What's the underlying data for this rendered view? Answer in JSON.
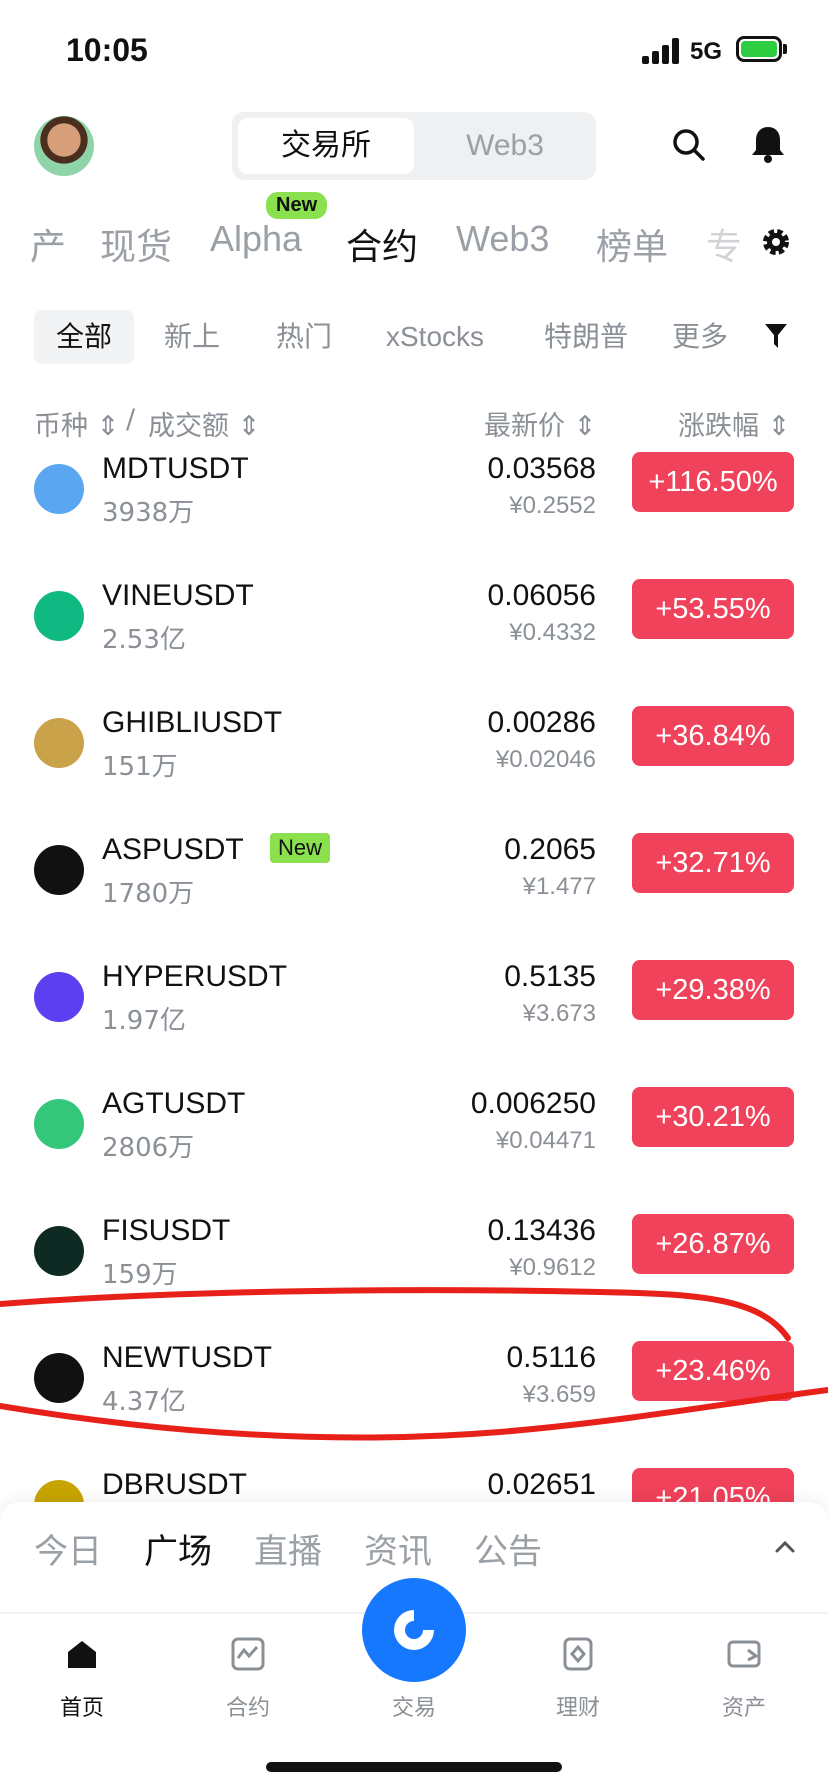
{
  "status_bar": {
    "time": "10:05",
    "network": "5G"
  },
  "header": {
    "segment": [
      "交易所",
      "Web3"
    ]
  },
  "main_tabs": {
    "items": [
      "产",
      "现货",
      "Alpha",
      "合约",
      "Web3",
      "榜单",
      "专"
    ],
    "active": "合约",
    "badge": "New"
  },
  "filters": {
    "items": [
      "全部",
      "新上",
      "热门",
      "xStocks",
      "特朗普",
      "更多"
    ],
    "active": "全部"
  },
  "columns": {
    "coin": "币种",
    "slash": "/",
    "volume": "成交额",
    "price": "最新价",
    "change": "涨跌幅"
  },
  "rows": [
    {
      "symbol": "MDTUSDT",
      "volume": "3938万",
      "price": "0.03568",
      "cny": "¥0.2552",
      "change": "+116.50%"
    },
    {
      "symbol": "VINEUSDT",
      "volume": "2.53亿",
      "price": "0.06056",
      "cny": "¥0.4332",
      "change": "+53.55%"
    },
    {
      "symbol": "GHIBLIUSDT",
      "volume": "151万",
      "price": "0.00286",
      "cny": "¥0.02046",
      "change": "+36.84%"
    },
    {
      "symbol": "ASPUSDT",
      "badge": "New",
      "volume": "1780万",
      "price": "0.2065",
      "cny": "¥1.477",
      "change": "+32.71%"
    },
    {
      "symbol": "HYPERUSDT",
      "volume": "1.97亿",
      "price": "0.5135",
      "cny": "¥3.673",
      "change": "+29.38%"
    },
    {
      "symbol": "AGTUSDT",
      "volume": "2806万",
      "price": "0.006250",
      "cny": "¥0.04471",
      "change": "+30.21%"
    },
    {
      "symbol": "FISUSDT",
      "volume": "159万",
      "price": "0.13436",
      "cny": "¥0.9612",
      "change": "+26.87%"
    },
    {
      "symbol": "NEWTUSDT",
      "volume": "4.37亿",
      "price": "0.5116",
      "cny": "¥3.659",
      "change": "+23.46%"
    },
    {
      "symbol": "DBRUSDT",
      "price": "0.02651",
      "change": "+21.05%"
    }
  ],
  "sheet_tabs": {
    "items": [
      "今日",
      "广场",
      "直播",
      "资讯",
      "公告"
    ],
    "active": "广场"
  },
  "bottom_nav": {
    "items": [
      "首页",
      "合约",
      "交易",
      "理财",
      "资产"
    ],
    "active": "首页"
  },
  "colors": {
    "up": "#f0425a",
    "accent": "#1677ff",
    "new_badge": "#8be04e",
    "annotation": "#e8201a"
  }
}
